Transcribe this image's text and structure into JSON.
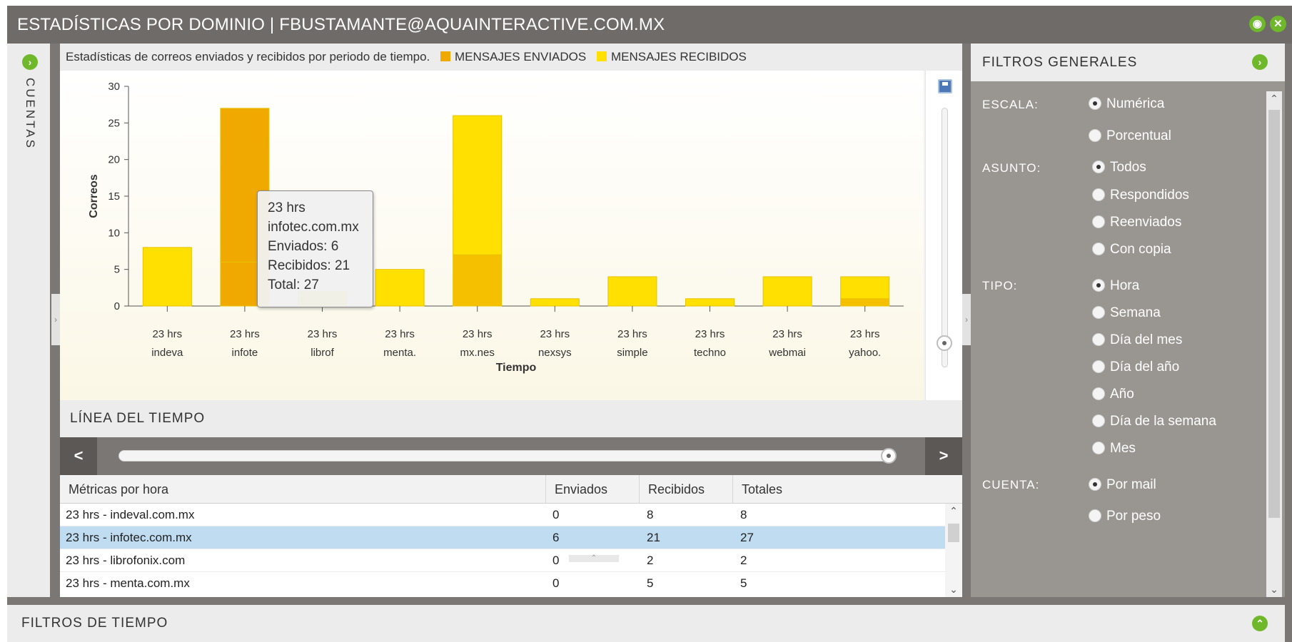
{
  "window": {
    "title": "ESTADÍSTICAS POR DOMINIO | FBUSTAMANTE@AQUAINTERACTIVE.COM.MX"
  },
  "sidebar": {
    "label": "CUENTAS"
  },
  "chart_header": {
    "description": "Estadísticas de correos enviados y recibidos por periodo de tiempo.",
    "legend": [
      {
        "label": "MENSAJES ENVIADOS",
        "color": "#f0a900"
      },
      {
        "label": "MENSAJES RECIBIDOS",
        "color": "#ffe000"
      }
    ]
  },
  "chart_data": {
    "type": "bar",
    "stacked": true,
    "xlabel": "Tiempo",
    "ylabel": "Correos",
    "ylim": [
      0,
      30
    ],
    "yticks": [
      0,
      5,
      10,
      15,
      20,
      25,
      30
    ],
    "categories": [
      [
        "23 hrs",
        "indeva"
      ],
      [
        "23 hrs",
        "infote"
      ],
      [
        "23 hrs",
        "librof"
      ],
      [
        "23 hrs",
        "menta."
      ],
      [
        "23 hrs",
        "mx.nes"
      ],
      [
        "23 hrs",
        "nexsys"
      ],
      [
        "23 hrs",
        "simple"
      ],
      [
        "23 hrs",
        "techno"
      ],
      [
        "23 hrs",
        "webmai"
      ],
      [
        "23 hrs",
        "yahoo."
      ]
    ],
    "series": [
      {
        "name": "MENSAJES ENVIADOS",
        "values": [
          0,
          6,
          0,
          0,
          7,
          0,
          0,
          0,
          0,
          1
        ],
        "color": "#f5c000"
      },
      {
        "name": "MENSAJES RECIBIDOS",
        "values": [
          8,
          21,
          2,
          5,
          19,
          1,
          4,
          1,
          4,
          3
        ],
        "color": "#ffe000"
      }
    ],
    "highlight_index": 1,
    "highlight_color": "#f0a900",
    "tooltip": [
      "23 hrs",
      "infotec.com.mx",
      "Enviados: 6",
      "Recibidos: 21",
      "Total: 27"
    ]
  },
  "timeline": {
    "title": "LÍNEA DEL TIEMPO",
    "prev_label": "<",
    "next_label": ">"
  },
  "grid": {
    "headers": [
      "Métricas por hora",
      "Enviados",
      "Recibidos",
      "Totales"
    ],
    "rows": [
      [
        "23 hrs - indeval.com.mx",
        "0",
        "8",
        "8"
      ],
      [
        "23 hrs - infotec.com.mx",
        "6",
        "21",
        "27"
      ],
      [
        "23 hrs - librofonix.com",
        "0",
        "2",
        "2"
      ],
      [
        "23 hrs - menta.com.mx",
        "0",
        "5",
        "5"
      ]
    ],
    "selected_row": 1
  },
  "filters": {
    "title": "FILTROS GENERALES",
    "escala": {
      "label": "ESCALA:",
      "options": [
        "Numérica",
        "Porcentual"
      ],
      "selected": 0
    },
    "asunto": {
      "label": "ASUNTO:",
      "options": [
        "Todos",
        "Respondidos",
        "Reenviados",
        "Con copia"
      ],
      "selected": 0
    },
    "tipo": {
      "label": "TIPO:",
      "options": [
        "Hora",
        "Semana",
        "Día del mes",
        "Día del año",
        "Año",
        "Día de la semana",
        "Mes"
      ],
      "selected": 0
    },
    "cuenta": {
      "label": "CUENTA:",
      "options": [
        "Por mail",
        "Por peso"
      ],
      "selected": 0
    }
  },
  "footer": {
    "title": "FILTROS DE TIEMPO"
  }
}
